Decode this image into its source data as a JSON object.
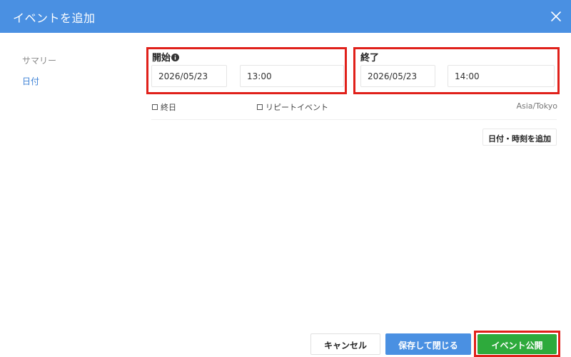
{
  "header": {
    "title": "イベントを追加"
  },
  "sidebar": {
    "items": [
      {
        "label": "サマリー"
      },
      {
        "label": "日付"
      }
    ]
  },
  "start": {
    "label": "開始",
    "date": "2026/05/23",
    "time": "13:00"
  },
  "end": {
    "label": "終了",
    "date": "2026/05/23",
    "time": "14:00"
  },
  "options": {
    "all_day": "終日",
    "repeat_event": "リピートイベント",
    "timezone": "Asia/Tokyo"
  },
  "add_datetime_label": "日付・時刻を追加",
  "footer": {
    "cancel": "キャンセル",
    "save_close": "保存して閉じる",
    "publish": "イベント公開"
  },
  "colors": {
    "header": "#4a90e2",
    "accent_blue": "#4a90e2",
    "publish_green": "#2eaa3c",
    "highlight_red": "#e0201a"
  }
}
